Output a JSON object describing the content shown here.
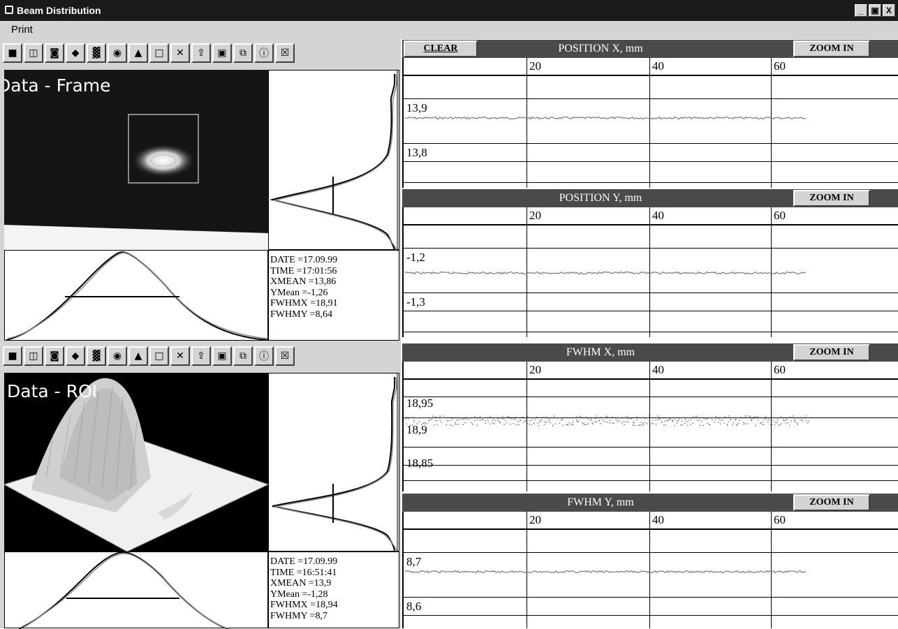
{
  "window": {
    "title": "Beam Distribution",
    "buttons": {
      "minimize": "_",
      "maximize": "З",
      "close": "X"
    }
  },
  "menu": {
    "print": "Print"
  },
  "frame_panel": {
    "image_label": "Data - Frame",
    "info": [
      "DATE =17.09.99",
      "TIME =17:01:56",
      "XMEAN =13,86",
      "YMean =-1,26",
      "FWHMX =18,91",
      "FWHMY =8,64"
    ]
  },
  "roi_panel": {
    "image_label": "Data - ROI",
    "info": [
      "DATE =17.09.99",
      "TIME =16:51:41",
      "XMEAN =13,9",
      "YMean =-1,28",
      "FWHMX =18,94",
      "FWHMY =8,7"
    ]
  },
  "clear_button": "CLEAR",
  "zoom_label": "ZOOM IN",
  "toolbar_icons": [
    "stop-icon",
    "snapshot-icon",
    "camera-icon",
    "diamond-icon",
    "texture-icon",
    "point-icon",
    "peak-icon",
    "square-icon",
    "delete-icon",
    "open-icon",
    "save-icon",
    "copy-icon",
    "info-icon",
    "close-icon"
  ],
  "charts": [
    {
      "title": "POSITION X, mm",
      "x_ticks": [
        "20",
        "40",
        "60"
      ],
      "y_labels": [
        "13,9",
        "13,8"
      ],
      "trace": "flat-noise"
    },
    {
      "title": "POSITION Y, mm",
      "x_ticks": [
        "20",
        "40",
        "60"
      ],
      "y_labels": [
        "-1,2",
        "-1,3"
      ],
      "trace": "flat-noise"
    },
    {
      "title": "FWHM X, mm",
      "x_ticks": [
        "20",
        "40",
        "60"
      ],
      "y_labels": [
        "18,95",
        "18,9",
        "18,85"
      ],
      "trace": "scatter-noise"
    },
    {
      "title": "FWHM Y, mm",
      "x_ticks": [
        "20",
        "40",
        "60"
      ],
      "y_labels": [
        "8,7",
        "8,6"
      ],
      "trace": "flat-noise"
    }
  ],
  "colors": {
    "titlebar": "#1a1a1a",
    "chart_header": "#4a4a4a",
    "face": "#d4d4d4",
    "trace": "#777777"
  }
}
